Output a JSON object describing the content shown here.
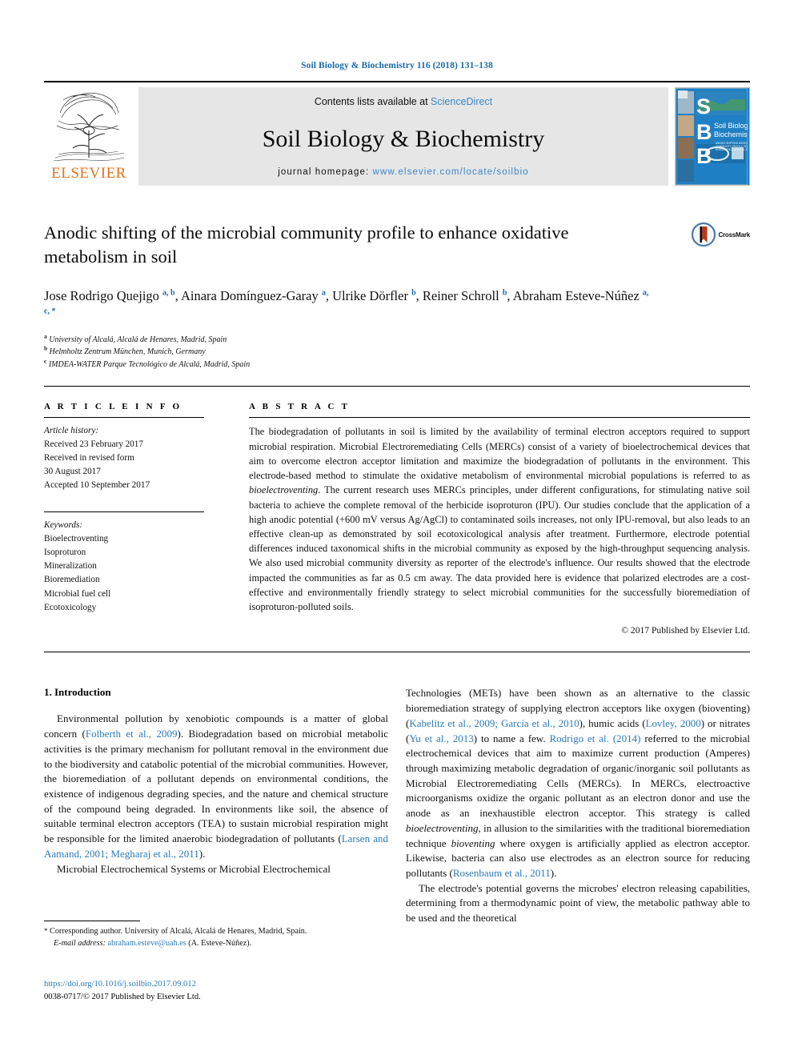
{
  "running_head": "Soil Biology & Biochemistry 116 (2018) 131–138",
  "banner": {
    "publisher": "ELSEVIER",
    "contents_prefix": "Contents lists available at ",
    "contents_link": "ScienceDirect",
    "journal_title": "Soil Biology & Biochemistry",
    "homepage_prefix": "journal homepage: ",
    "homepage_url": "www.elsevier.com/locate/soilbio",
    "cover_letters": "SBB",
    "cover_title_line1": "Soil Biology &",
    "cover_title_line2": "Biochemistry"
  },
  "article": {
    "title": "Anodic shifting of the microbial community profile to enhance oxidative metabolism in soil",
    "crossmark_label": "CrossMark",
    "authors_html": "Jose Rodrigo Quejigo <sup>a, b</sup>, Ainara Domínguez-Garay <sup>a</sup>, Ulrike Dörfler <sup>b</sup>, Reiner Schroll <sup>b</sup>, Abraham Esteve-Núñez <sup>a, c, *</sup>",
    "affiliations": [
      {
        "mark": "a",
        "text": "University of Alcalá, Alcalá de Henares, Madrid, Spain"
      },
      {
        "mark": "b",
        "text": "Helmholtz Zentrum München, Munich, Germany"
      },
      {
        "mark": "c",
        "text": "IMDEA-WATER Parque Tecnológico de Alcalá, Madrid, Spain"
      }
    ]
  },
  "article_info": {
    "heading": "A R T I C L E  I N F O",
    "history_label": "Article history:",
    "history": [
      "Received 23 February 2017",
      "Received in revised form",
      "30 August 2017",
      "Accepted 10 September 2017"
    ],
    "keywords_label": "Keywords:",
    "keywords": [
      "Bioelectroventing",
      "Isoproturon",
      "Mineralization",
      "Bioremediation",
      "Microbial fuel cell",
      "Ecotoxicology"
    ]
  },
  "abstract": {
    "heading": "A B S T R A C T",
    "text_html": "The biodegradation of pollutants in soil is limited by the availability of terminal electron acceptors required to support microbial respiration. Microbial Electroremediating Cells (MERCs) consist of a variety of bioelectrochemical devices that aim to overcome electron acceptor limitation and maximize the biodegradation of pollutants in the environment. This electrode-based method to stimulate the oxidative metabolism of environmental microbial populations is referred to as <i>bioelectroventing</i>. The current research uses MERCs principles, under different configurations, for stimulating native soil bacteria to achieve the complete removal of the herbicide isoproturon (IPU). Our studies conclude that the application of a high anodic potential (+600 mV versus Ag/AgCl) to contaminated soils increases, not only IPU-removal, but also leads to an effective clean-up as demonstrated by soil ecotoxicological analysis after treatment. Furthermore, electrode potential differences induced taxonomical shifts in the microbial community as exposed by the high-throughput sequencing analysis. We also used microbial community diversity as reporter of the electrode's influence. Our results showed that the electrode impacted the communities as far as 0.5 cm away. The data provided here is evidence that polarized electrodes are a cost-effective and environmentally friendly strategy to select microbial communities for the successfully bioremediation of isoproturon-polluted soils.",
    "copyright": "© 2017 Published by Elsevier Ltd."
  },
  "body": {
    "section_heading": "1. Introduction",
    "left_paragraphs_html": [
      "Environmental pollution by xenobiotic compounds is a matter of global concern (<span class=\"ref\">Folberth et al., 2009</span>). Biodegradation based on microbial metabolic activities is the primary mechanism for pollutant removal in the environment due to the biodiversity and catabolic potential of the microbial communities. However, the bioremediation of a pollutant depends on environmental conditions, the existence of indigenous degrading species, and the nature and chemical structure of the compound being degraded. In environments like soil, the absence of suitable terminal electron acceptors (TEA) to sustain microbial respiration might be responsible for the limited anaerobic biodegradation of pollutants (<span class=\"ref\">Larsen and Aamand, 2001; Megharaj et al., 2011</span>).",
      "Microbial Electrochemical Systems or Microbial Electrochemical"
    ],
    "right_paragraphs_html": [
      "Technologies (METs) have been shown as an alternative to the classic bioremediation strategy of supplying electron acceptors like oxygen (bioventing) (<span class=\"ref\">Kabelitz et al., 2009; García et al., 2010</span>), humic acids (<span class=\"ref\">Lovley, 2000</span>) or nitrates (<span class=\"ref\">Yu et al., 2013</span>) to name a few. <span class=\"ref\">Rodrigo et al. (2014)</span> referred to the microbial electrochemical devices that aim to maximize current production (Amperes) through maximizing metabolic degradation of organic/inorganic soil pollutants as Microbial Electroremediating Cells (MERCs). In MERCs, electroactive microorganisms oxidize the organic pollutant as an electron donor and use the anode as an inexhaustible electron acceptor. This strategy is called <i>bioelectroventing</i>, in allusion to the similarities with the traditional bioremediation technique <i>bioventing</i> where oxygen is artificially applied as electron acceptor. Likewise, bacteria can also use electrodes as an electron source for reducing pollutants (<span class=\"ref\">Rosenbaum et al., 2011</span>).",
      "The electrode's potential governs the microbes' electron releasing capabilities, determining from a thermodynamic point of view, the metabolic pathway able to be used and the theoretical"
    ],
    "right_paragraph_flags": [
      false,
      true
    ]
  },
  "footnote": {
    "star": "*",
    "corresponding_html": "Corresponding author. University of Alcalá, Alcalá de Henares, Madrid, Spain.",
    "email_label": "E-mail address:",
    "email": "abraham.esteve@uah.es",
    "email_suffix": "(A. Esteve-Núñez)."
  },
  "page_footer": {
    "doi": "https://doi.org/10.1016/j.soilbio.2017.09.012",
    "issn_line": "0038-0717/© 2017 Published by Elsevier Ltd."
  },
  "colors": {
    "link_blue": "#2b7bb9",
    "header_blue": "#1a6ba8",
    "elsevier_orange": "#E9711C",
    "banner_gray": "#e6e6e6",
    "cover_blue": "#1f7fc4"
  }
}
